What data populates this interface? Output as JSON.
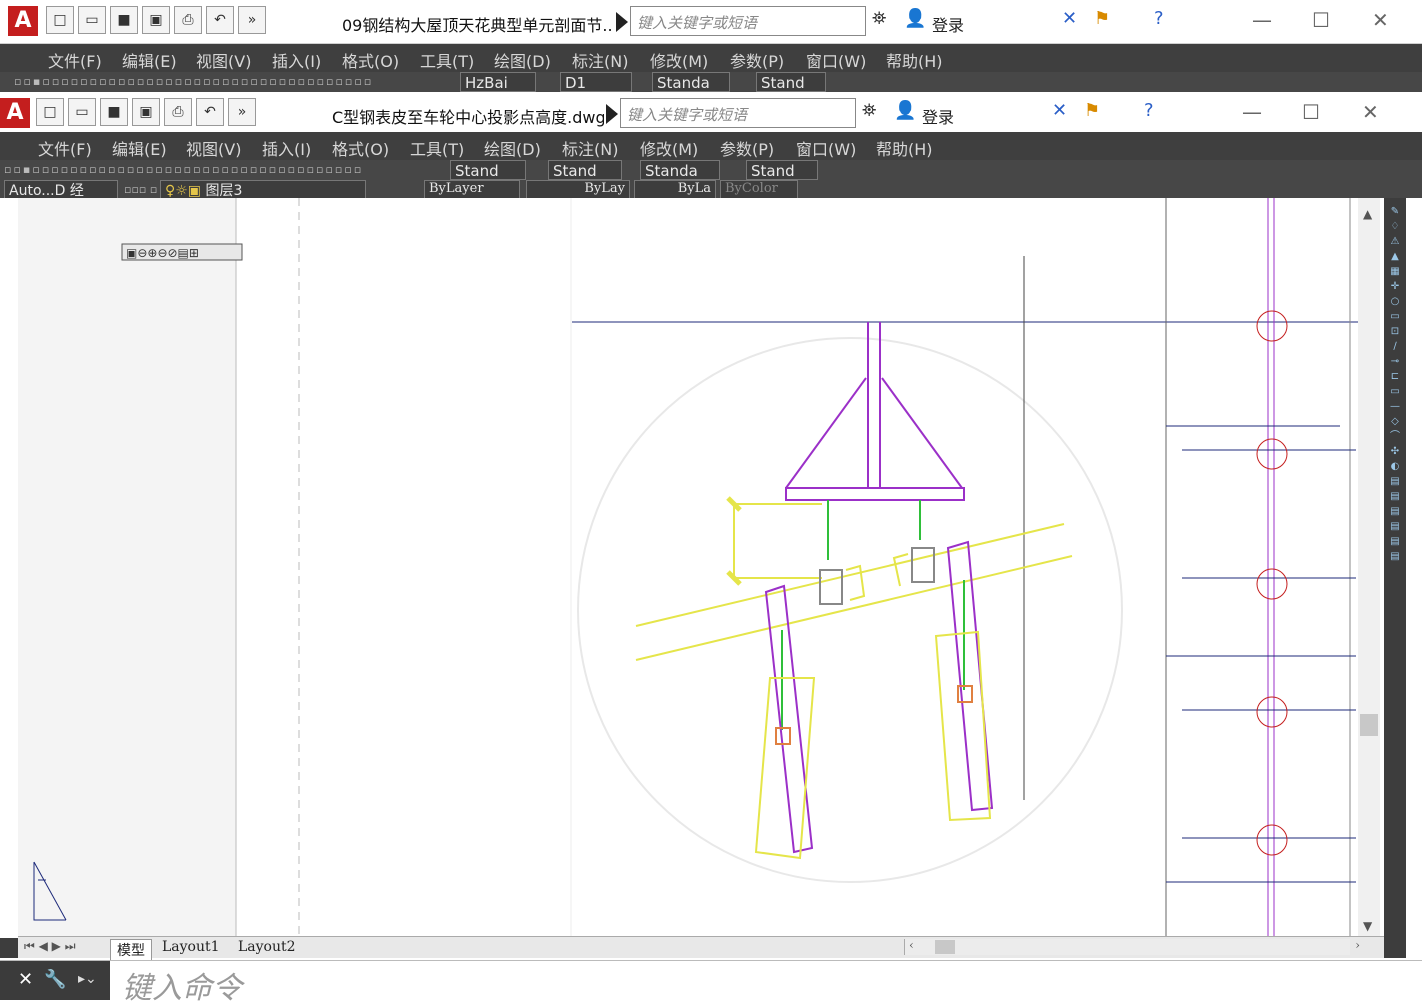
{
  "back_window": {
    "title": "09钢结构大屋顶天花典型单元剖面节...",
    "search_placeholder": "键入关键字或短语",
    "login": "登录",
    "menu": [
      "文件(F)",
      "编辑(E)",
      "视图(V)",
      "插入(I)",
      "格式(O)",
      "工具(T)",
      "绘图(D)",
      "标注(N)",
      "修改(M)",
      "参数(P)",
      "窗口(W)",
      "帮助(H)"
    ],
    "toolbar_dropdowns": [
      "HzBai",
      "D1",
      "Standa",
      "Stand"
    ]
  },
  "front_window": {
    "title": "C型钢表皮至车轮中心投影点高度.dwg",
    "search_placeholder": "键入关键字或短语",
    "login": "登录",
    "menu": [
      "文件(F)",
      "编辑(E)",
      "视图(V)",
      "插入(I)",
      "格式(O)",
      "工具(T)",
      "绘图(D)",
      "标注(N)",
      "修改(M)",
      "参数(P)",
      "窗口(W)",
      "帮助(H)"
    ],
    "style_dropdowns": [
      "Stand",
      "Stand",
      "Standa",
      "Stand"
    ],
    "workspace": "Auto...D 经",
    "layer": "图层3",
    "color": "ByLayer",
    "linetype": "ByLay",
    "lineweight": "ByLa",
    "plotstyle": "ByColor"
  },
  "tabs": [
    "模型",
    "Layout1",
    "Layout2"
  ],
  "command_placeholder": "键入命令",
  "colors": {
    "accent": "#c41e1e",
    "drawing_magenta": "#9b30c8",
    "drawing_yellow": "#e5e54a",
    "drawing_green": "#2fbf3a",
    "drawing_navy": "#1d2a7a"
  }
}
